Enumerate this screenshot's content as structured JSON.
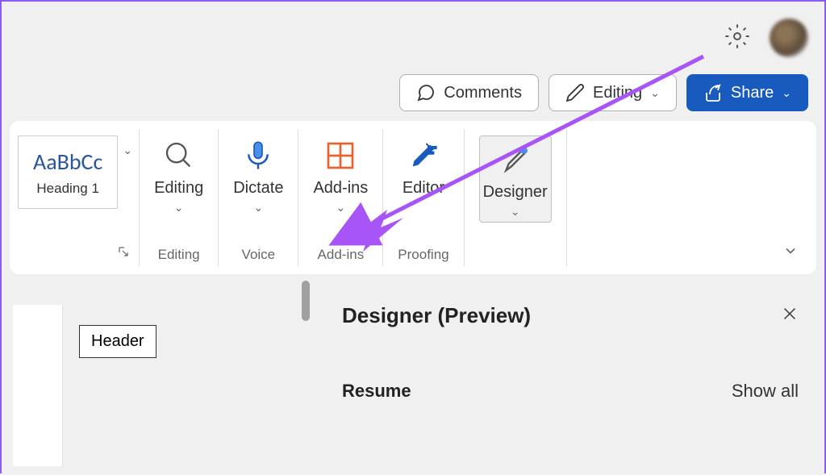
{
  "topbar": {
    "settings_icon": "settings"
  },
  "actions": {
    "comments": "Comments",
    "editing": "Editing",
    "share": "Share"
  },
  "ribbon": {
    "style": {
      "sample": "AaBbCc",
      "name": "Heading 1"
    },
    "groups": {
      "editing": {
        "label": "Editing",
        "item": "Editing"
      },
      "voice": {
        "label": "Voice",
        "item": "Dictate"
      },
      "addins": {
        "label": "Add-ins",
        "item": "Add-ins"
      },
      "proofing": {
        "label": "Proofing",
        "item": "Editor"
      },
      "designer": {
        "item": "Designer"
      }
    }
  },
  "document": {
    "header_label": "Header"
  },
  "designer_pane": {
    "title": "Designer (Preview)",
    "section": "Resume",
    "show_all": "Show all"
  }
}
